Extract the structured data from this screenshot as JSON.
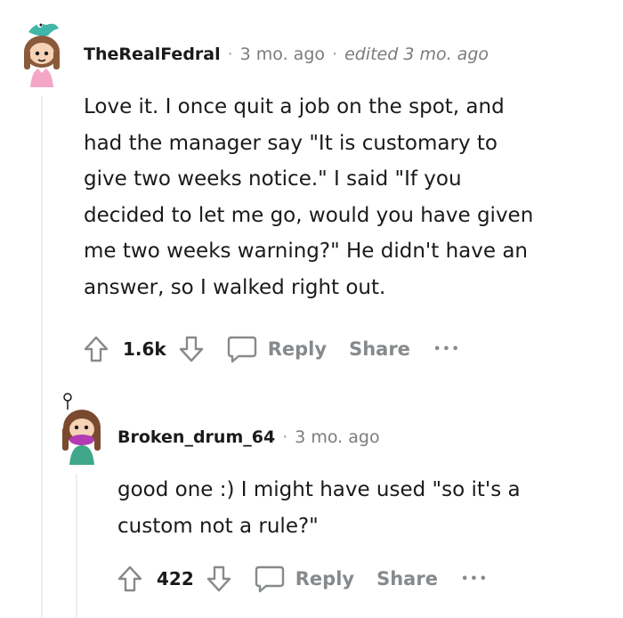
{
  "comments": [
    {
      "username": "TheRealFedral",
      "time": "3 mo. ago",
      "edited": "edited 3 mo. ago",
      "body": [
        "Love it. I once quit a job on the spot, and",
        "had the manager say \"It is customary to",
        "give two weeks notice.\" I said \"If you",
        "decided to let me go, would you have given",
        "me two weeks warning?\" He didn't have an",
        "answer, so I walked right out."
      ],
      "votes": "1.6k",
      "reply_label": "Reply",
      "share_label": "Share",
      "more_label": "•••"
    },
    {
      "username": "Broken_drum_64",
      "time": "3 mo. ago",
      "body": [
        "good one :) I might have used \"so it's a",
        "custom not a rule?\""
      ],
      "votes": "422",
      "reply_label": "Reply",
      "share_label": "Share",
      "more_label": "•••"
    }
  ],
  "separator": "·",
  "colors": {
    "text": "#1a1a1b",
    "meta": "#7c7c7c",
    "action": "#878a8c",
    "thread_line": "#edeff1"
  },
  "icons": [
    "avatar-1",
    "avatar-2",
    "upvote-arrow-icon",
    "downvote-arrow-icon",
    "comment-bubble-icon",
    "more-dots-icon"
  ]
}
